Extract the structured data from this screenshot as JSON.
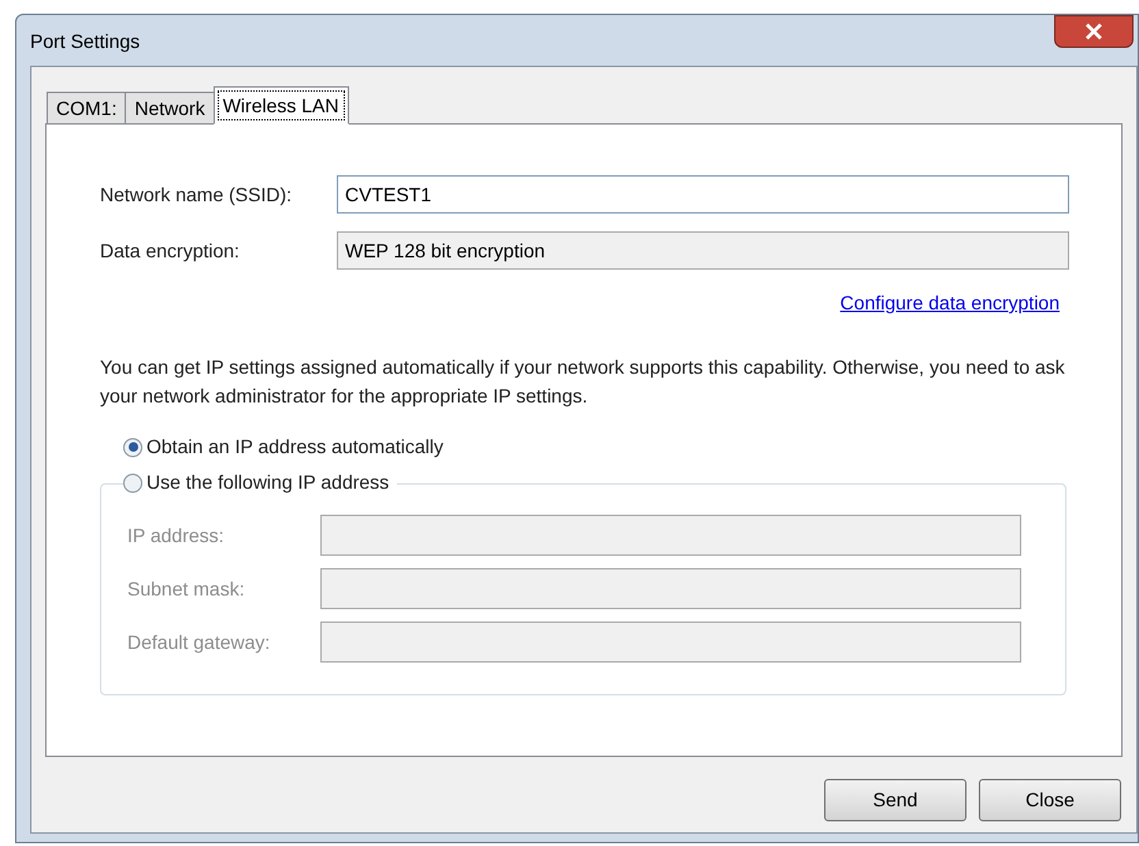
{
  "window": {
    "title": "Port Settings"
  },
  "tabs": [
    {
      "label": "COM1:",
      "selected": false
    },
    {
      "label": "Network",
      "selected": false
    },
    {
      "label": "Wireless LAN",
      "selected": true
    }
  ],
  "fields": [
    {
      "label": "Network name (SSID):",
      "value": "CVTEST1",
      "read_only": false
    },
    {
      "label": "Data encryption:",
      "value": "WEP 128 bit encryption",
      "read_only": true
    }
  ],
  "link": "Configure data encryption",
  "description": "You can get IP settings assigned automatically if your network supports this capability. Otherwise, you need to ask your network administrator for the appropriate IP settings.",
  "ip_modes": [
    {
      "label": "Obtain an IP address automatically",
      "selected": true
    },
    {
      "label": "Use the following IP address",
      "selected": false
    }
  ],
  "ip_fields": [
    {
      "label": "IP address:",
      "disabled": true
    },
    {
      "label": "Subnet mask:",
      "disabled": true
    },
    {
      "label": "Default gateway:",
      "disabled": true
    }
  ],
  "buttons": [
    "Send",
    "Close"
  ]
}
